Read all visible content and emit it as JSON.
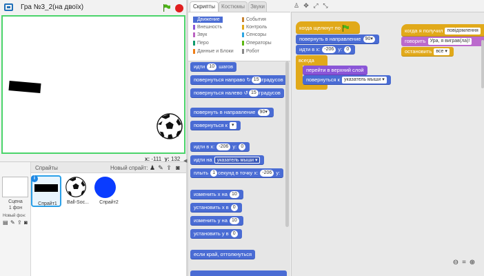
{
  "project": {
    "title": "Гра №3_2(на двоїх)"
  },
  "stage": {
    "mouse_x_label": "x:",
    "mouse_x": "-111",
    "mouse_y_label": "y:",
    "mouse_y": "132"
  },
  "sprites_pane": {
    "header": "Спрайты",
    "new_sprite_label": "Новый спрайт:",
    "stage_label": "Сцена\n1 фон",
    "new_backdrop_label": "Новый фон:",
    "sprites": [
      {
        "name": "Спрайт1"
      },
      {
        "name": "Ball-Soc..."
      },
      {
        "name": "Спрайт2"
      }
    ]
  },
  "tabs": [
    "Скрипты",
    "Костюмы",
    "Звуки"
  ],
  "categories": [
    {
      "label": "Движение",
      "color": "#4a6cd4"
    },
    {
      "label": "Внешность",
      "color": "#8a55d7"
    },
    {
      "label": "Звук",
      "color": "#bb63c1"
    },
    {
      "label": "Перо",
      "color": "#0e9a6c"
    },
    {
      "label": "Данные и Блоки",
      "color": "#ee7d16"
    },
    {
      "label": "События",
      "color": "#c88330"
    },
    {
      "label": "Контроль",
      "color": "#e1a91a"
    },
    {
      "label": "Сенсоры",
      "color": "#2ca5e2"
    },
    {
      "label": "Операторы",
      "color": "#5cb712"
    },
    {
      "label": "Робот",
      "color": "#888888"
    }
  ],
  "palette": {
    "move": {
      "label": "идти",
      "value": "10",
      "suffix": "шагов"
    },
    "turn_right": {
      "label": "повернуться направо",
      "value": "15",
      "suffix": "градусов"
    },
    "turn_left": {
      "label": "повернуться налево",
      "value": "15",
      "suffix": "градусов"
    },
    "point_dir": {
      "label": "повернуть в направление",
      "value": "90▾"
    },
    "point_towards": {
      "label": "повернуться к",
      "value": "▾"
    },
    "goto_xy": {
      "label": "идти в x:",
      "x": "-206",
      "y_label": "y:",
      "y": "0"
    },
    "goto": {
      "label": "идти на",
      "value": "указатель мыши ▾"
    },
    "glide": {
      "label": "плыть",
      "secs": "1",
      "mid": "секунд в точку x:",
      "x": "-206",
      "y_label": "y:"
    },
    "change_x": {
      "label": "изменить х на",
      "value": "10"
    },
    "set_x": {
      "label": "установить х в",
      "value": "0"
    },
    "change_y": {
      "label": "изменить у на",
      "value": "10"
    },
    "set_y": {
      "label": "установить у в",
      "value": "0"
    },
    "bounce": {
      "label": "если край, оттолкнуться"
    }
  },
  "script1": {
    "hat": "когда щелкнут по",
    "point_dir": {
      "label": "повернуть в направление",
      "value": "90▾"
    },
    "goto_xy": {
      "label": "идти в x:",
      "x": "-206",
      "y_label": "y:",
      "y": "0"
    },
    "forever": "всегда",
    "front": "перейти в верхний слой",
    "point_towards": {
      "label": "повернуться к",
      "value": "указатель мыши ▾"
    }
  },
  "script2": {
    "hat": {
      "label": "когда я получил",
      "value": "повідомлення"
    },
    "say": {
      "label": "говорить",
      "value": "Ура, я виграв(ла)!"
    },
    "stop": {
      "label": "остановить",
      "value": "все ▾"
    }
  }
}
